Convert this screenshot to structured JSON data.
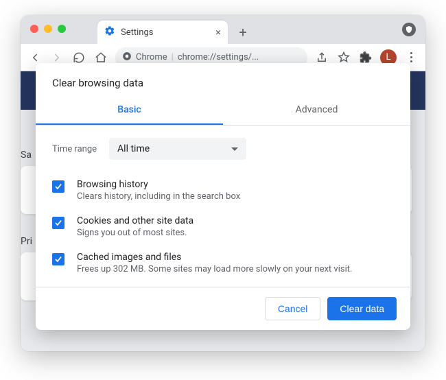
{
  "tab": {
    "title": "Settings"
  },
  "toolbar": {
    "label": "Chrome",
    "url": "chrome://settings/...",
    "avatar_initial": "L"
  },
  "background": {
    "left_labels": [
      "Sa",
      "Pri"
    ]
  },
  "dialog": {
    "title": "Clear browsing data",
    "tabs": {
      "basic": "Basic",
      "advanced": "Advanced"
    },
    "time_range_label": "Time range",
    "time_range_value": "All time",
    "items": [
      {
        "title": "Browsing history",
        "desc": "Clears history, including in the search box"
      },
      {
        "title": "Cookies and other site data",
        "desc": "Signs you out of most sites."
      },
      {
        "title": "Cached images and files",
        "desc": "Frees up 302 MB. Some sites may load more slowly on your next visit."
      }
    ],
    "cancel_label": "Cancel",
    "confirm_label": "Clear data"
  }
}
